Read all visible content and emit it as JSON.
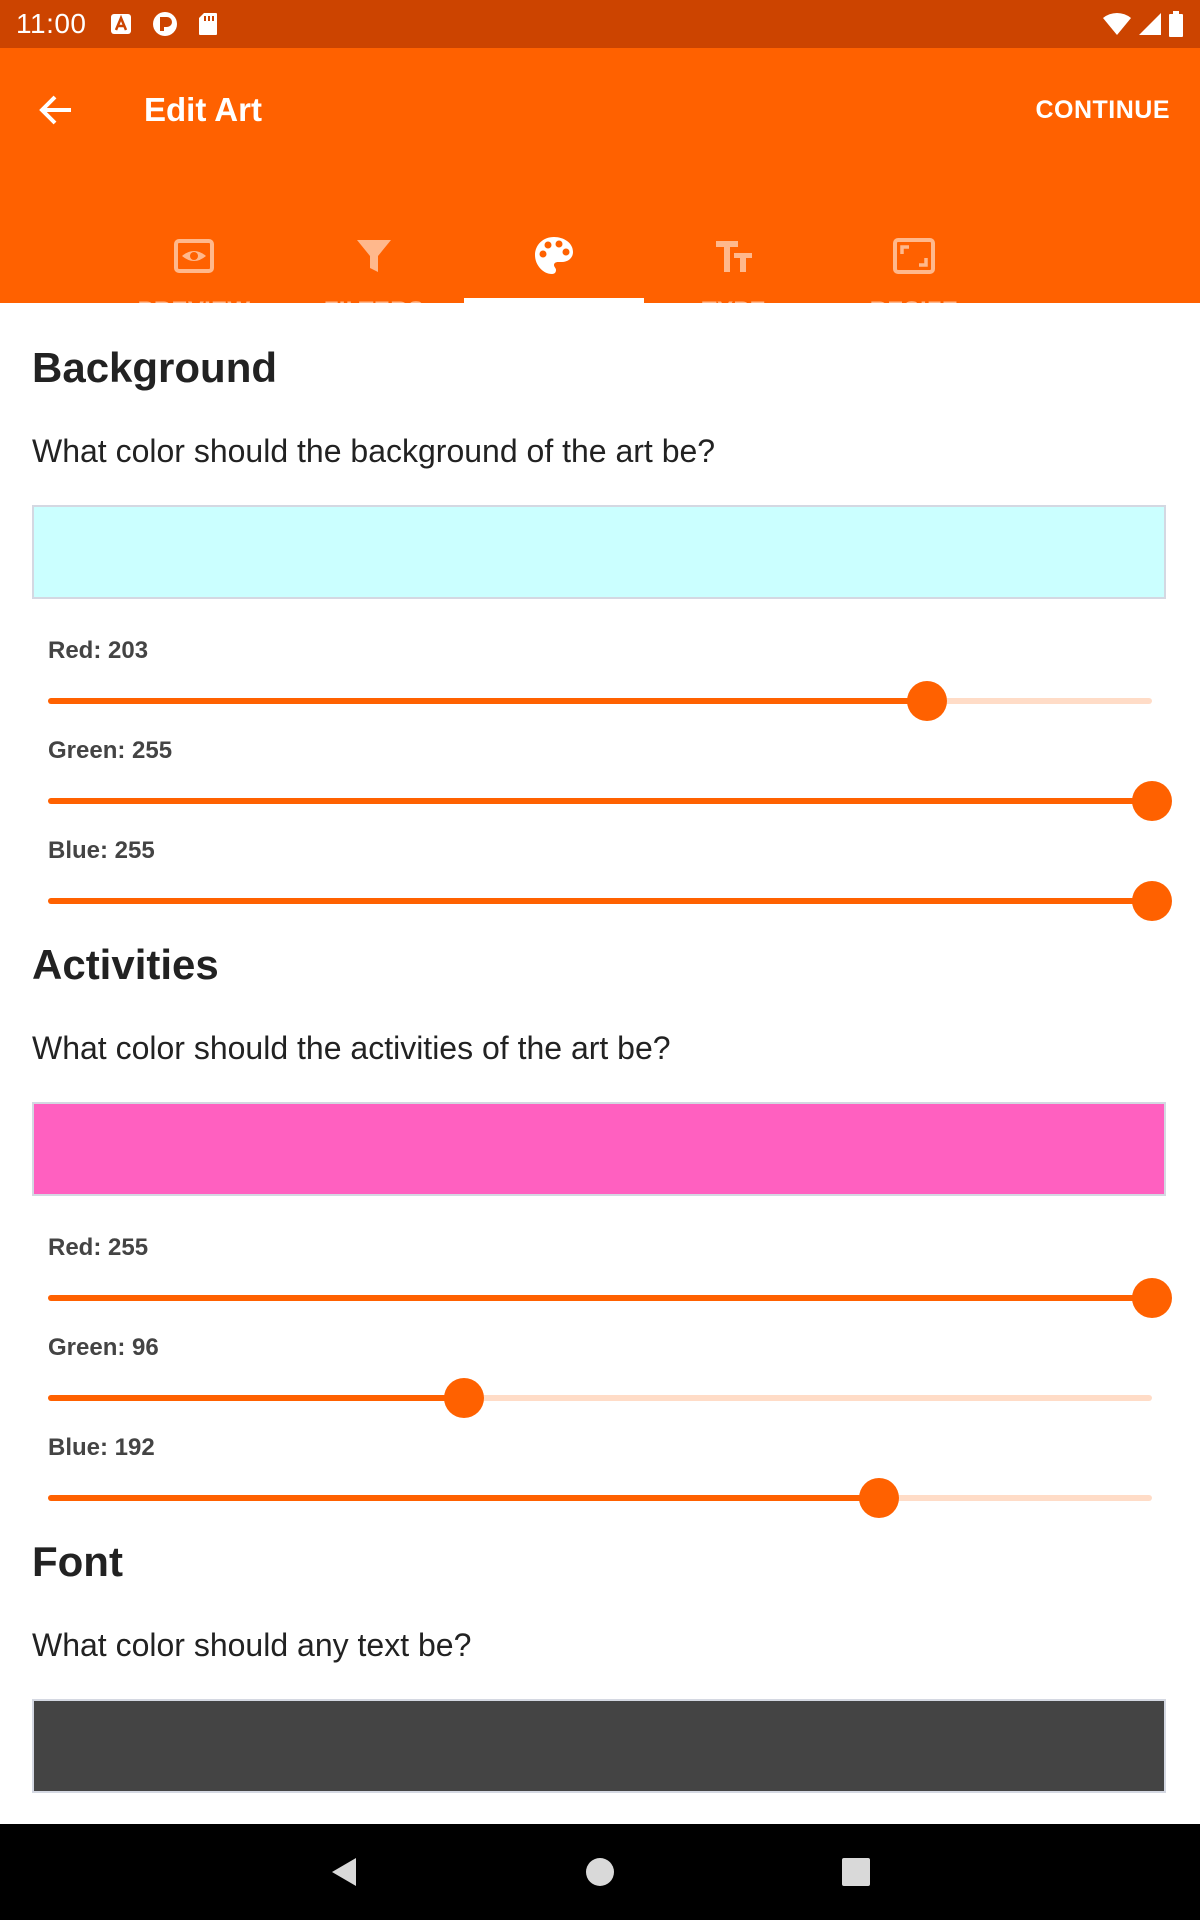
{
  "status_bar": {
    "time": "11:00",
    "notification_icons": [
      "font-a-icon",
      "pocket-icon",
      "sd-card-icon"
    ],
    "system_icons": [
      "wifi-icon",
      "signal-icon",
      "battery-icon"
    ]
  },
  "app_bar": {
    "back_icon": "arrow-back-icon",
    "title": "Edit Art",
    "continue_label": "CONTINUE",
    "color": "#ff6100"
  },
  "tabs": [
    {
      "label": "PREVIEW",
      "icon": "eye-preview-icon",
      "active": false
    },
    {
      "label": "FILTERS",
      "icon": "funnel-filter-icon",
      "active": false
    },
    {
      "label": "STYLE",
      "icon": "palette-icon",
      "active": true
    },
    {
      "label": "TYPE",
      "icon": "text-type-icon",
      "active": false
    },
    {
      "label": "RESIZE",
      "icon": "resize-frame-icon",
      "active": false
    }
  ],
  "sections": {
    "background": {
      "title": "Background",
      "question": "What color should the background of the art be?",
      "swatch_color": "#cbffff",
      "sliders": [
        {
          "label": "Red: 203",
          "value": 203,
          "max": 255
        },
        {
          "label": "Green: 255",
          "value": 255,
          "max": 255
        },
        {
          "label": "Blue: 255",
          "value": 255,
          "max": 255
        }
      ]
    },
    "activities": {
      "title": "Activities",
      "question": "What color should the activities of the art be?",
      "swatch_color": "#ff60c0",
      "sliders": [
        {
          "label": "Red: 255",
          "value": 255,
          "max": 255
        },
        {
          "label": "Green: 96",
          "value": 96,
          "max": 255
        },
        {
          "label": "Blue: 192",
          "value": 192,
          "max": 255
        }
      ]
    },
    "font": {
      "title": "Font",
      "question": "What color should any text be?",
      "swatch_color": "#444444"
    }
  },
  "colors": {
    "accent": "#ff6100",
    "status_bar": "#cc4400",
    "slider_track": "#ffdcc7"
  },
  "nav_bar": {
    "buttons": [
      "back-triangle-icon",
      "home-circle-icon",
      "recents-square-icon"
    ]
  }
}
